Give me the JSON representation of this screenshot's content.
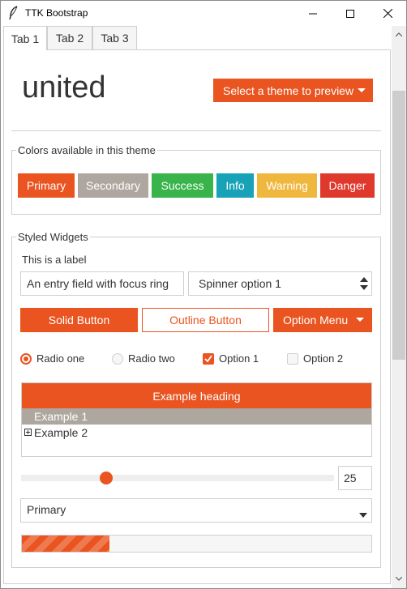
{
  "window": {
    "title": "TTK Bootstrap"
  },
  "tabs": [
    {
      "label": "Tab 1"
    },
    {
      "label": "Tab 2"
    },
    {
      "label": "Tab 3"
    }
  ],
  "header": {
    "theme_name": "united",
    "theme_select": "Select a theme to preview"
  },
  "colors_group": {
    "label": "Colors available in this theme",
    "buttons": [
      {
        "label": "Primary",
        "color": "#e95420"
      },
      {
        "label": "Secondary",
        "color": "#aea79f"
      },
      {
        "label": "Success",
        "color": "#38b44a"
      },
      {
        "label": "Info",
        "color": "#17a2b8"
      },
      {
        "label": "Warning",
        "color": "#efb73e"
      },
      {
        "label": "Danger",
        "color": "#df382c"
      }
    ]
  },
  "widgets_group": {
    "label": "Styled Widgets",
    "static_label": "This is a label",
    "entry_value": "An entry field with focus ring",
    "spinner_value": "Spinner option 1",
    "solid_button": "Solid Button",
    "outline_button": "Outline Button",
    "option_menu": "Option Menu",
    "radio_one": "Radio one",
    "radio_two": "Radio two",
    "option1": "Option 1",
    "option2": "Option 2",
    "tree_heading": "Example heading",
    "tree_items": [
      "Example 1",
      "Example 2"
    ],
    "scale_value": "25",
    "scale_fraction": 0.25,
    "combobox_value": "Primary",
    "progress_fraction": 0.25
  },
  "accent_color": "#e95420"
}
